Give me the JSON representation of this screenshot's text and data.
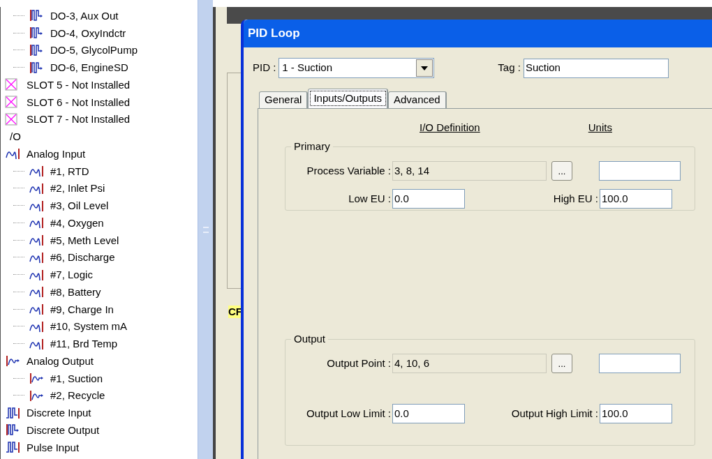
{
  "tree": [
    {
      "children": [
        {
          "label": "DO-3, Aux Out",
          "kind": "do"
        },
        {
          "label": "DO-4, OxyIndctr",
          "kind": "do"
        },
        {
          "label": "DO-5, GlycolPump",
          "kind": "do"
        },
        {
          "label": "DO-6, EngineSD",
          "kind": "do"
        }
      ]
    },
    {
      "label": "SLOT 5 - Not Installed",
      "kind": "slot"
    },
    {
      "label": "SLOT 6 - Not Installed",
      "kind": "slot"
    },
    {
      "label": "SLOT 7 - Not Installed",
      "kind": "slot"
    },
    {
      "label": "/O",
      "kind": "plain"
    },
    {
      "label": "Analog Input",
      "kind": "ai",
      "children": [
        {
          "label": "#1, RTD",
          "kind": "ai"
        },
        {
          "label": "#2, Inlet Psi",
          "kind": "ai"
        },
        {
          "label": "#3, Oil Level",
          "kind": "ai"
        },
        {
          "label": "#4, Oxygen",
          "kind": "ai"
        },
        {
          "label": "#5, Meth Level",
          "kind": "ai"
        },
        {
          "label": "#6, Discharge",
          "kind": "ai"
        },
        {
          "label": "#7, Logic",
          "kind": "ai"
        },
        {
          "label": "#8, Battery",
          "kind": "ai"
        },
        {
          "label": "#9, Charge In",
          "kind": "ai"
        },
        {
          "label": "#10, System mA",
          "kind": "ai"
        },
        {
          "label": "#11, Brd Temp",
          "kind": "ai"
        }
      ]
    },
    {
      "label": "Analog Output",
      "kind": "ao",
      "children": [
        {
          "label": "#1, Suction",
          "kind": "ao"
        },
        {
          "label": "#2, Recycle",
          "kind": "ao"
        }
      ]
    },
    {
      "label": "Discrete Input",
      "kind": "di"
    },
    {
      "label": "Discrete Output",
      "kind": "do"
    },
    {
      "label": "Pulse Input",
      "kind": "pi"
    }
  ],
  "background_app": {
    "label": "CF"
  },
  "dialog": {
    "title": "PID Loop",
    "pid": {
      "label": "PID :",
      "value": "1 - Suction"
    },
    "tag": {
      "label": "Tag :",
      "value": "Suction"
    },
    "tabs": [
      {
        "label": "General",
        "selected": false
      },
      {
        "label": "Inputs/Outputs",
        "selected": true
      },
      {
        "label": "Advanced",
        "selected": false
      }
    ],
    "headers": [
      "I/O Definition",
      "Units"
    ],
    "groups": [
      {
        "title": "Primary",
        "point": {
          "label": "Process Variable :",
          "value": "3, 8, 14",
          "button": "..."
        },
        "low": {
          "label": "Low EU :",
          "value": "0.0"
        },
        "high": {
          "label": "High EU :",
          "value": "100.0"
        }
      },
      {
        "title": "Output",
        "point": {
          "label": "Output Point :",
          "value": "4, 10, 6",
          "button": "..."
        },
        "low": {
          "label": "Output Low Limit :",
          "value": "0.0"
        },
        "high": {
          "label": "Output High Limit :",
          "value": "100.0"
        }
      }
    ]
  }
}
